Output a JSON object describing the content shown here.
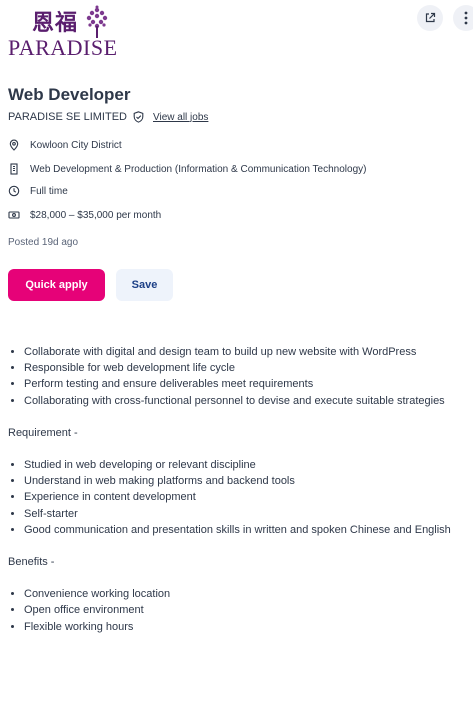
{
  "logo": {
    "chinese": "恩福",
    "wordmark": "PARADISE"
  },
  "header_actions": {
    "share_icon": "external-link-icon",
    "more_icon": "more-vertical-icon"
  },
  "job": {
    "title": "Web Developer",
    "company": "PARADISE SE LIMITED",
    "view_all_jobs": "View all jobs",
    "location": "Kowloon City District",
    "classification": "Web Development & Production (Information & Communication Technology)",
    "work_type": "Full time",
    "salary": "$28,000 – $35,000 per month",
    "posted": "Posted 19d ago"
  },
  "actions": {
    "quick_apply": "Quick apply",
    "save": "Save"
  },
  "description": {
    "duties": [
      "Collaborate with digital and design team to build up new website with WordPress",
      "Responsible for web development life cycle",
      "Perform testing and ensure deliverables meet requirements",
      "Collaborating with cross-functional personnel to devise and execute suitable strategies"
    ],
    "requirement_heading": "Requirement -",
    "requirements": [
      "Studied in web developing or relevant discipline",
      "Understand in web making platforms and backend tools",
      "Experience in content development",
      "Self-starter",
      "Good communication and presentation skills in written and spoken Chinese and English"
    ],
    "benefits_heading": "Benefits -",
    "benefits": [
      "Convenience working location",
      "Open office environment",
      "Flexible working hours"
    ]
  },
  "colors": {
    "primary": "#e60278",
    "brand": "#5a1e6e",
    "text": "#2e3849",
    "save_bg": "#eef3fb",
    "save_text": "#1c3f86"
  }
}
